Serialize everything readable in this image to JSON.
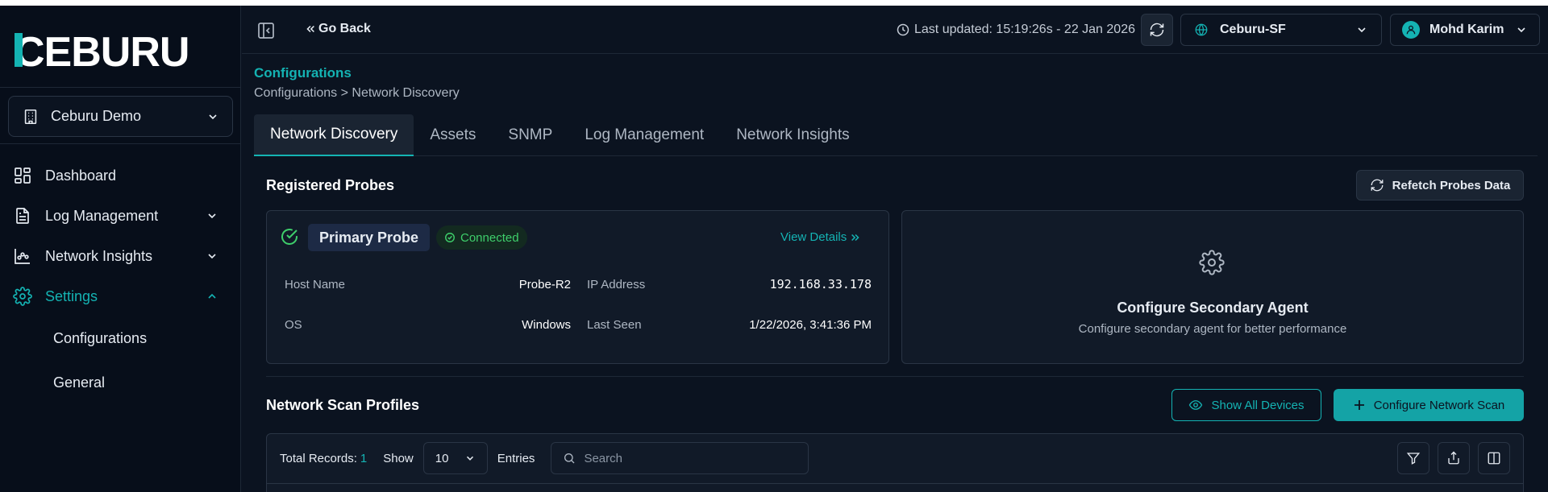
{
  "brand": {
    "logo_text": "CEBURU",
    "accent": "#14b3b3"
  },
  "sidebar": {
    "org": "Ceburu Demo",
    "items": [
      {
        "label": "Dashboard",
        "icon": "dashboard-icon"
      },
      {
        "label": "Log Management",
        "icon": "document-icon"
      },
      {
        "label": "Network Insights",
        "icon": "chart-icon"
      },
      {
        "label": "Settings",
        "icon": "gear-icon"
      }
    ],
    "subitems": [
      {
        "label": "Configurations"
      },
      {
        "label": "General"
      }
    ]
  },
  "header": {
    "go_back": "Go Back",
    "last_updated": "Last updated: 15:19:26s - 22 Jan 2026",
    "site": "Ceburu-SF",
    "user": "Mohd Karim"
  },
  "page": {
    "title": "Configurations",
    "breadcrumb": "Configurations > Network Discovery"
  },
  "tabs": [
    {
      "label": "Network Discovery"
    },
    {
      "label": "Assets"
    },
    {
      "label": "SNMP"
    },
    {
      "label": "Log Management"
    },
    {
      "label": "Network Insights"
    }
  ],
  "probes": {
    "section_title": "Registered Probes",
    "refetch_label": "Refetch Probes Data",
    "primary": {
      "name": "Primary Probe",
      "status": "Connected",
      "status_color": "#3ecf6b",
      "view_details": "View Details",
      "host_name_label": "Host Name",
      "host_name": "Probe-R2",
      "ip_label": "IP Address",
      "ip": "192.168.33.178",
      "os_label": "OS",
      "os": "Windows",
      "last_seen_label": "Last Seen",
      "last_seen": "1/22/2026, 3:41:36 PM"
    },
    "secondary": {
      "title": "Configure Secondary Agent",
      "subtitle": "Configure secondary agent for better performance"
    }
  },
  "scan_profiles": {
    "section_title": "Network Scan Profiles",
    "show_all_devices": "Show All Devices",
    "configure_scan": "Configure Network Scan",
    "total_records_label": "Total Records:",
    "total_records": "1",
    "show_label": "Show",
    "entries_value": "10",
    "entries_label": "Entries",
    "search_placeholder": "Search"
  }
}
